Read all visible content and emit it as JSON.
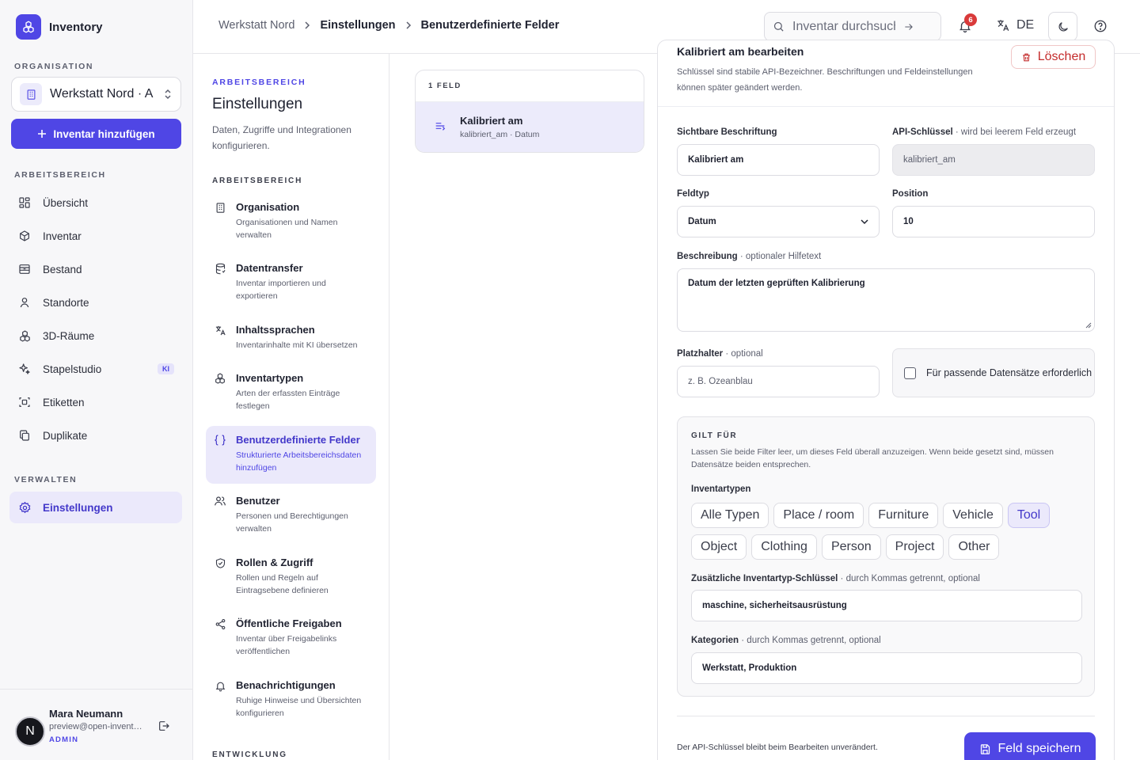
{
  "app": {
    "name": "Inventory",
    "accent": "#4f46e5"
  },
  "sidebar": {
    "org_label": "ORGANISATION",
    "org_name": "Werkstatt Nord · A",
    "add_button": "Inventar hinzufügen",
    "workspace_label": "ARBEITSBEREICH",
    "workspace_items": [
      {
        "label": "Übersicht",
        "icon": "grid-icon"
      },
      {
        "label": "Inventar",
        "icon": "box-icon"
      },
      {
        "label": "Bestand",
        "icon": "archive-icon"
      },
      {
        "label": "Standorte",
        "icon": "location-icon"
      },
      {
        "label": "3D-Räume",
        "icon": "cubes-icon"
      },
      {
        "label": "Stapelstudio",
        "icon": "sparkle-icon",
        "badge": "KI"
      },
      {
        "label": "Etiketten",
        "icon": "scan-icon"
      },
      {
        "label": "Duplikate",
        "icon": "copy-icon"
      }
    ],
    "manage_label": "VERWALTEN",
    "manage_items": [
      {
        "label": "Einstellungen",
        "icon": "gear-icon",
        "active": true
      }
    ],
    "user": {
      "initial": "N",
      "name": "Mara Neumann",
      "email": "preview@open-inventory",
      "role": "ADMIN"
    }
  },
  "header": {
    "breadcrumb": [
      "Werkstatt Nord",
      "Einstellungen",
      "Benutzerdefinierte Felder"
    ],
    "search_placeholder": "Inventar durchsuchen",
    "notification_count": "6",
    "language": "DE"
  },
  "settings": {
    "eyebrow": "ARBEITSBEREICH",
    "title": "Einstellungen",
    "description": "Daten, Zugriffe und Integrationen konfigurieren.",
    "group_label": "ARBEITSBEREICH",
    "items": [
      {
        "title": "Organisation",
        "desc": "Organisationen und Namen verwalten",
        "icon": "building-icon"
      },
      {
        "title": "Datentransfer",
        "desc": "Inventar importieren und exportieren",
        "icon": "database-icon"
      },
      {
        "title": "Inhaltssprachen",
        "desc": "Inventarinhalte mit KI übersetzen",
        "icon": "translate-icon"
      },
      {
        "title": "Inventartypen",
        "desc": "Arten der erfassten Einträge festlegen",
        "icon": "cubes-icon"
      },
      {
        "title": "Benutzerdefinierte Felder",
        "desc": "Strukturierte Arbeitsbereichsdaten hinzufügen",
        "icon": "braces-icon",
        "active": true
      },
      {
        "title": "Benutzer",
        "desc": "Personen und Berechtigungen verwalten",
        "icon": "users-icon"
      },
      {
        "title": "Rollen & Zugriff",
        "desc": "Rollen und Regeln auf Eintragsebene definieren",
        "icon": "shield-icon"
      },
      {
        "title": "Öffentliche Freigaben",
        "desc": "Inventar über Freigabelinks veröffentlichen",
        "icon": "share-icon"
      },
      {
        "title": "Benachrichtigungen",
        "desc": "Ruhige Hinweise und Übersichten konfigurieren",
        "icon": "bell-icon"
      }
    ],
    "group2_label": "ENTWICKLUNG"
  },
  "field_list": {
    "count_label": "1 FELD",
    "items": [
      {
        "title": "Kalibriert am",
        "subtitle": "kalibriert_am · Datum"
      }
    ]
  },
  "editor": {
    "title": "Kalibriert am bearbeiten",
    "subtitle": "Schlüssel sind stabile API-Bezeichner. Beschriftungen und Feldeinstellungen können später geändert werden.",
    "delete_button": "Löschen",
    "label_label": "Sichtbare Beschriftung",
    "label_value": "Kalibriert am",
    "key_label": "API-Schlüssel",
    "key_hint": "· wird bei leerem Feld erzeugt",
    "key_value": "kalibriert_am",
    "type_label": "Feldtyp",
    "type_value": "Datum",
    "position_label": "Position",
    "position_value": "10",
    "desc_label": "Beschreibung",
    "desc_hint": "· optionaler Hilfetext",
    "desc_value": "Datum der letzten geprüften Kalibrierung",
    "placeholder_label": "Platzhalter",
    "placeholder_hint": "· optional",
    "placeholder_placeholder": "z. B. Ozeanblau",
    "required_label": "Für passende Datensätze erforderlich",
    "required_checked": false,
    "applies": {
      "label": "GILT FÜR",
      "desc": "Lassen Sie beide Filter leer, um dieses Feld überall anzuzeigen. Wenn beide gesetzt sind, müssen Datensätze beiden entsprechen.",
      "types_label": "Inventartypen",
      "types": [
        {
          "label": "Alle Typen",
          "selected": false
        },
        {
          "label": "Place / room",
          "selected": false
        },
        {
          "label": "Furniture",
          "selected": false
        },
        {
          "label": "Vehicle",
          "selected": false
        },
        {
          "label": "Tool",
          "selected": true
        },
        {
          "label": "Object",
          "selected": false
        },
        {
          "label": "Clothing",
          "selected": false
        },
        {
          "label": "Person",
          "selected": false
        },
        {
          "label": "Project",
          "selected": false
        },
        {
          "label": "Other",
          "selected": false
        }
      ],
      "extra_keys_label": "Zusätzliche Inventartyp-Schlüssel",
      "extra_keys_hint": "· durch Kommas getrennt, optional",
      "extra_keys_value": "maschine, sicherheitsausrüstung",
      "categories_label": "Kategorien",
      "categories_hint": "· durch Kommas getrennt, optional",
      "categories_value": "Werkstatt, Produktion"
    },
    "footer_note": "Der API-Schlüssel bleibt beim Bearbeiten unverändert.",
    "save_button": "Feld speichern"
  }
}
